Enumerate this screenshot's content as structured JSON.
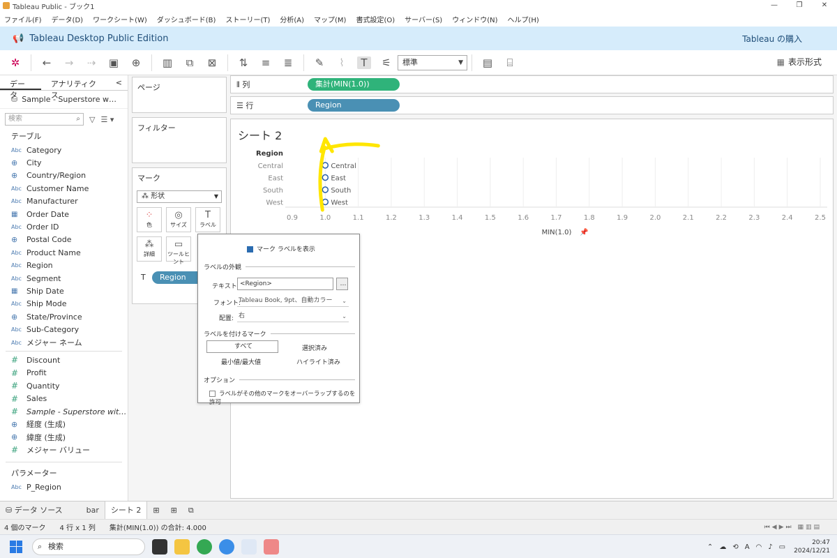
{
  "window": {
    "title": "Tableau Public - ブック1",
    "minimize": "—",
    "restore": "❐",
    "close": "✕"
  },
  "menu": [
    "ファイル(F)",
    "データ(D)",
    "ワークシート(W)",
    "ダッシュボード(B)",
    "ストーリー(T)",
    "分析(A)",
    "マップ(M)",
    "書式設定(O)",
    "サーバー(S)",
    "ウィンドウ(N)",
    "ヘルプ(H)"
  ],
  "banner": {
    "title": "Tableau Desktop Public Edition",
    "buy": "Tableau の購入"
  },
  "toolbar": {
    "fit_select": "標準",
    "show_me": "表示形式"
  },
  "datapane": {
    "tab_data": "データ",
    "tab_analytics": "アナリティクス",
    "collapse": "<",
    "datasource": "Sample - Superstore w…",
    "search_placeholder": "検索",
    "tables_header": "テーブル",
    "fields": [
      {
        "type": "Abc",
        "name": "Category"
      },
      {
        "type": "globe",
        "name": "City"
      },
      {
        "type": "globe",
        "name": "Country/Region"
      },
      {
        "type": "Abc",
        "name": "Customer Name"
      },
      {
        "type": "Abc",
        "name": "Manufacturer"
      },
      {
        "type": "cal",
        "name": "Order Date"
      },
      {
        "type": "Abc",
        "name": "Order ID"
      },
      {
        "type": "globe",
        "name": "Postal Code"
      },
      {
        "type": "Abc",
        "name": "Product Name"
      },
      {
        "type": "Abc",
        "name": "Region"
      },
      {
        "type": "Abc",
        "name": "Segment"
      },
      {
        "type": "cal",
        "name": "Ship Date"
      },
      {
        "type": "Abc",
        "name": "Ship Mode"
      },
      {
        "type": "globe",
        "name": "State/Province"
      },
      {
        "type": "Abc",
        "name": "Sub-Category"
      },
      {
        "type": "Abc",
        "name": "メジャー ネーム"
      }
    ],
    "measures": [
      {
        "type": "num",
        "name": "Discount"
      },
      {
        "type": "num",
        "name": "Profit"
      },
      {
        "type": "num",
        "name": "Quantity"
      },
      {
        "type": "num",
        "name": "Sales"
      },
      {
        "type": "num",
        "name": "Sample - Superstore wit…"
      },
      {
        "type": "globe",
        "name": "経度 (生成)"
      },
      {
        "type": "globe",
        "name": "緯度 (生成)"
      },
      {
        "type": "num",
        "name": "メジャー バリュー"
      }
    ],
    "params_header": "パラメーター",
    "params": [
      {
        "type": "Abc",
        "name": "P_Region"
      }
    ]
  },
  "shelves": {
    "pages": "ページ",
    "filters": "フィルター",
    "marks": "マーク",
    "mark_type": "形状",
    "mark_buttons": [
      "色",
      "サイズ",
      "ラベル",
      "詳細",
      "ツールヒント"
    ],
    "label_pill": "Region",
    "columns_label": "列",
    "columns_pill": "集計(MIN(1.0))",
    "rows_label": "行",
    "rows_pill": "Region"
  },
  "viz": {
    "sheet_title": "シート 2",
    "row_header": "Region",
    "regions": [
      "Central",
      "East",
      "South",
      "West"
    ],
    "x_ticks": [
      "0.9",
      "1.0",
      "1.1",
      "1.2",
      "1.3",
      "1.4",
      "1.5",
      "1.6",
      "1.7",
      "1.8",
      "1.9",
      "2.0",
      "2.1",
      "2.2",
      "2.3",
      "2.4",
      "2.5"
    ],
    "x_axis_title": "MIN(1.0)",
    "value": 1.0,
    "x_min": 0.9,
    "x_max": 2.5
  },
  "dialog": {
    "show_labels": "マーク ラベルを表示",
    "appearance": "ラベルの外観",
    "text_label": "テキスト:",
    "text_value": "<Region>",
    "more": "…",
    "font_label": "フォント:",
    "font_value": "Tableau Book, 9pt、自動カラー",
    "align_label": "配置:",
    "align_value": "右",
    "marks_to_label": "ラベルを付けるマーク",
    "all": "すべて",
    "selected": "選択済み",
    "minmax": "最小値/最大値",
    "highlighted": "ハイライト済み",
    "options": "オプション",
    "overlap": "ラベルがその他のマークをオーバーラップするのを許可"
  },
  "sheettabs": {
    "datasource": "データ ソース",
    "tabs": [
      "bar",
      "シート 2"
    ]
  },
  "status": {
    "marks": "4 個のマーク",
    "rowscols": "4 行 x 1 列",
    "sum": "集計(MIN(1.0)) の合計: 4.000"
  },
  "taskbar": {
    "search": "検索",
    "time": "20:47",
    "date": "2024/12/21",
    "ime": "A"
  },
  "colors": {
    "accent_green": "#2fb37a",
    "accent_blue": "#4a90b4",
    "annotation_yellow": "#ffe600"
  }
}
